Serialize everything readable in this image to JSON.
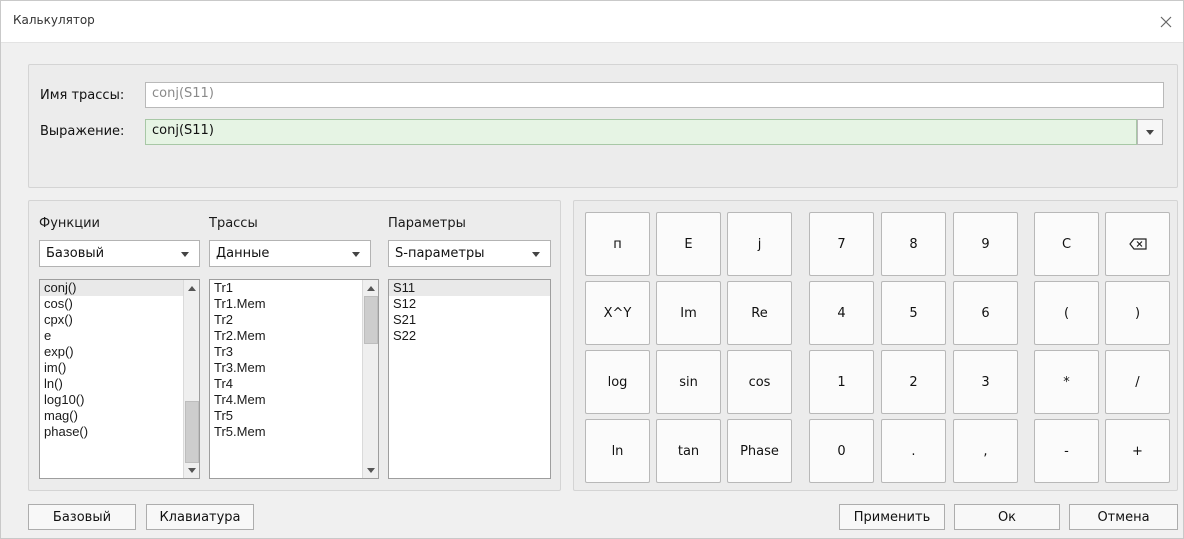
{
  "window": {
    "title": "Калькулятор"
  },
  "trace_name": {
    "label": "Имя трассы:",
    "value": "conj(S11)"
  },
  "expression": {
    "label": "Выражение:",
    "value": "conj(S11)"
  },
  "functions": {
    "title": "Функции",
    "selected": "Базовый",
    "items": [
      "conj()",
      "cos()",
      "cpx()",
      "e",
      "exp()",
      "im()",
      "ln()",
      "log10()",
      "mag()",
      "phase()"
    ]
  },
  "traces": {
    "title": "Трассы",
    "selected": "Данные",
    "items": [
      "Tr1",
      "Tr1.Mem",
      "Tr2",
      "Tr2.Mem",
      "Tr3",
      "Tr3.Mem",
      "Tr4",
      "Tr4.Mem",
      "Tr5",
      "Tr5.Mem"
    ]
  },
  "parameters": {
    "title": "Параметры",
    "selected": "S-параметры",
    "items": [
      "S11",
      "S12",
      "S21",
      "S22"
    ]
  },
  "keypad": {
    "rows": [
      [
        "п",
        "E",
        "j",
        "7",
        "8",
        "9",
        "C",
        "⌫"
      ],
      [
        "X^Y",
        "Im",
        "Re",
        "4",
        "5",
        "6",
        "(",
        ")"
      ],
      [
        "log",
        "sin",
        "cos",
        "1",
        "2",
        "3",
        "*",
        "/"
      ],
      [
        "ln",
        "tan",
        "Phase",
        "0",
        ".",
        ",",
        "-",
        "+"
      ]
    ]
  },
  "footer": {
    "basic": "Базовый",
    "keyboard": "Клавиатура",
    "apply": "Применить",
    "ok": "Ок",
    "cancel": "Отмена"
  }
}
